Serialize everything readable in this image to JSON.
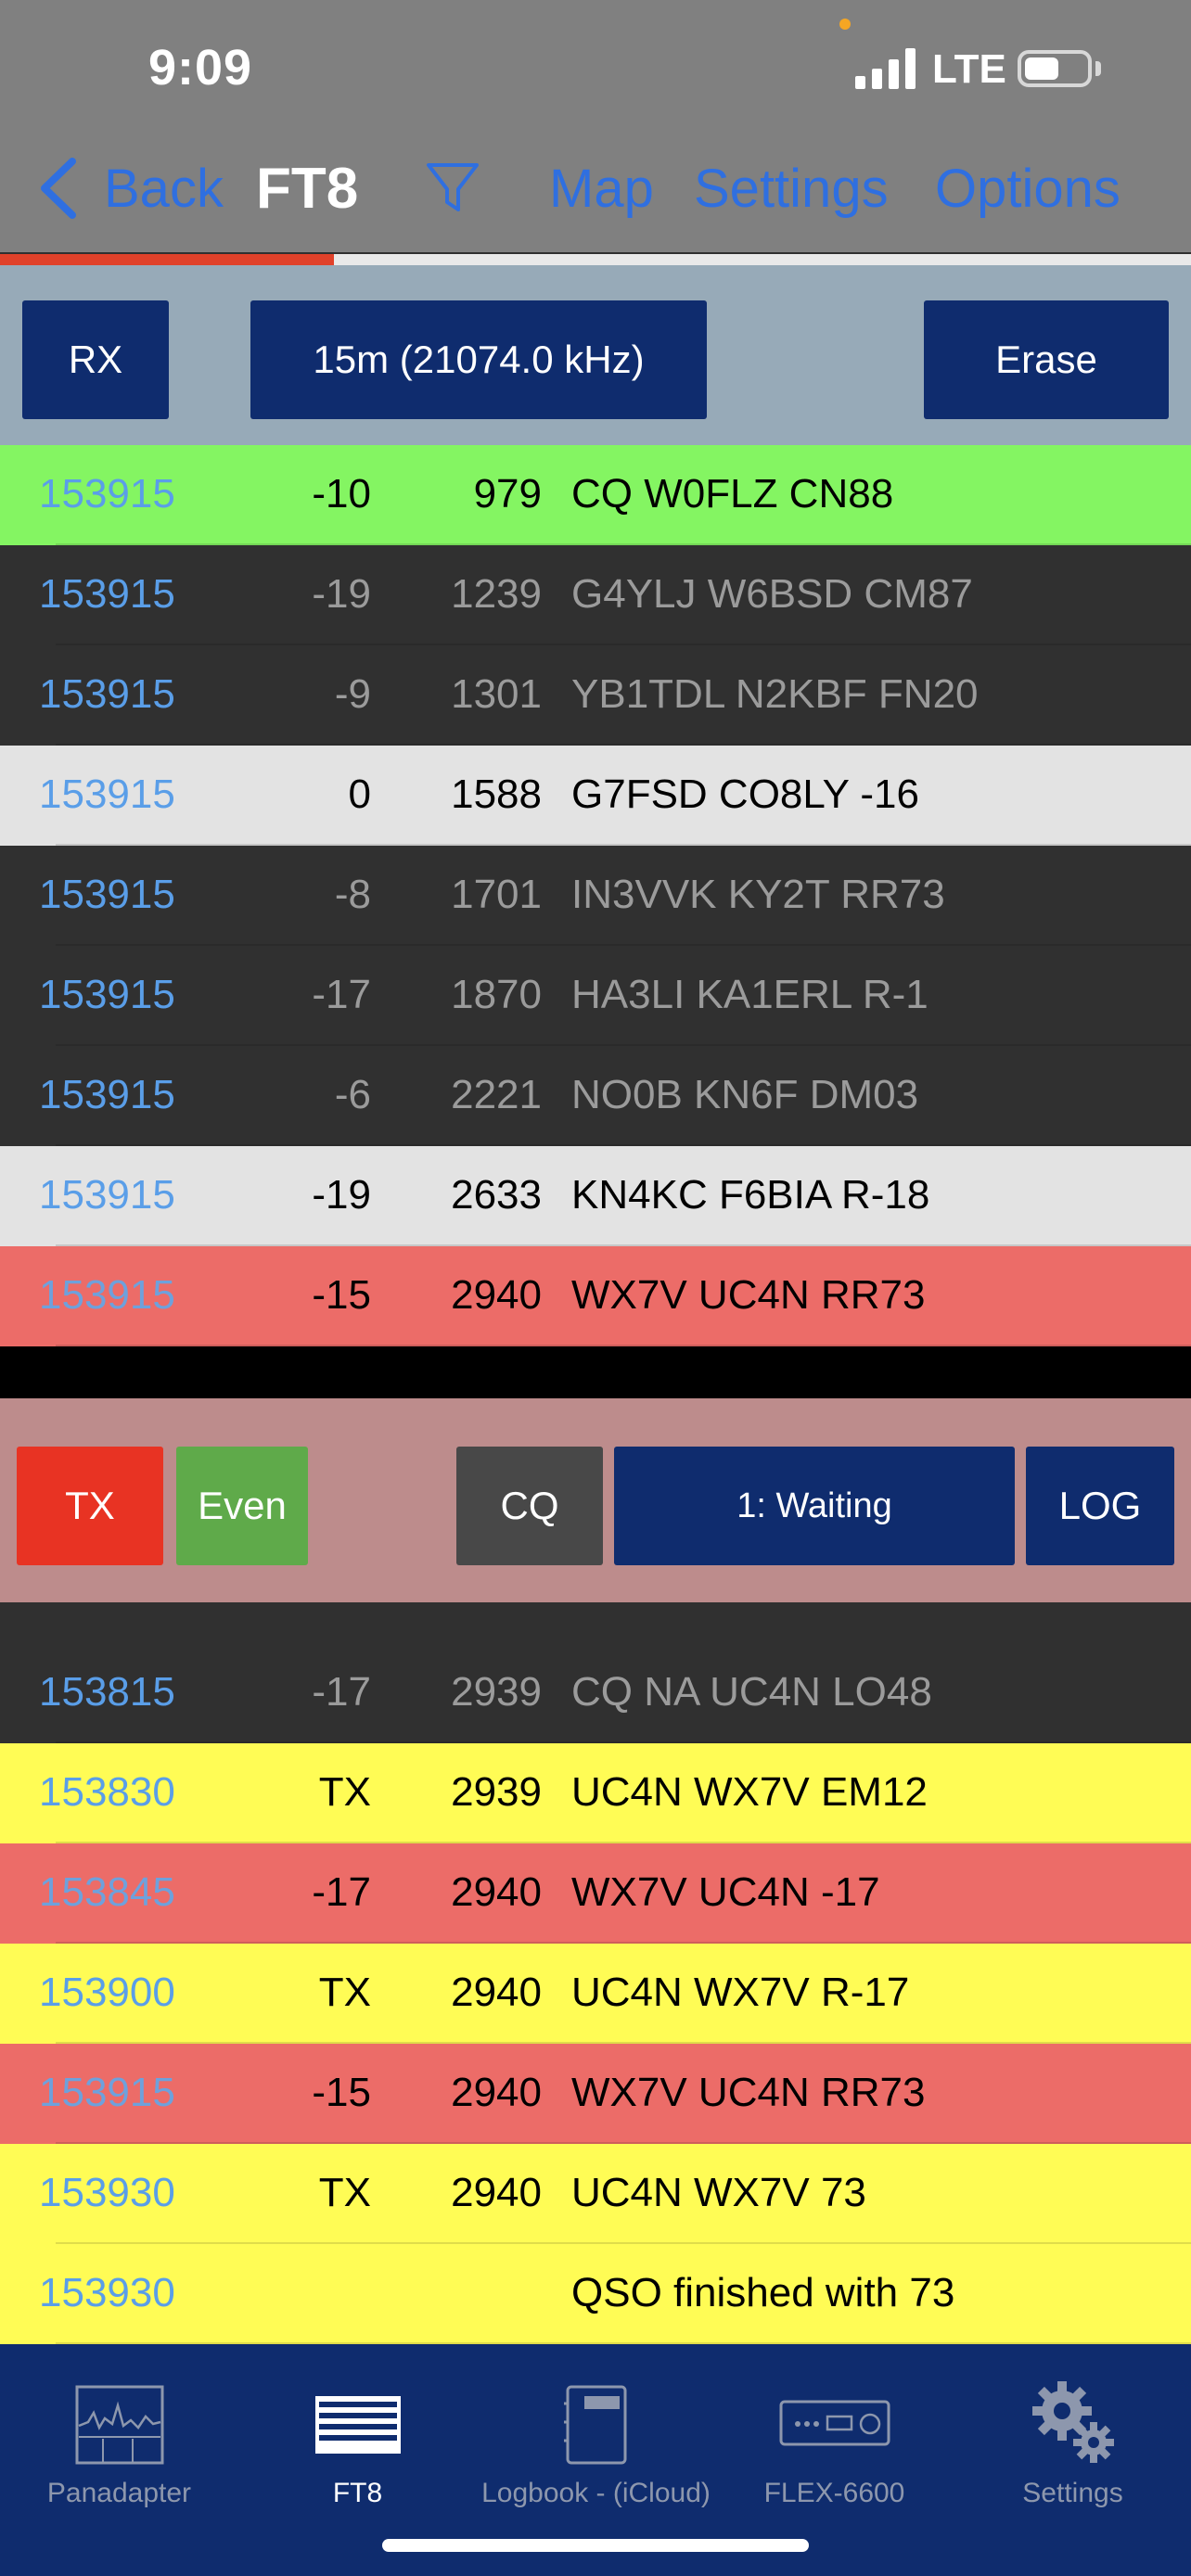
{
  "status": {
    "time": "9:09",
    "network": "LTE"
  },
  "nav": {
    "back": "Back",
    "title": "FT8",
    "map": "Map",
    "settings": "Settings",
    "options": "Options",
    "progress": 0.28
  },
  "controls": {
    "rx": "RX",
    "band": "15m (21074.0 kHz)",
    "erase": "Erase"
  },
  "decodes": [
    {
      "time": "153915",
      "db": "-10",
      "df": "979",
      "msg": "CQ W0FLZ CN88",
      "style": "green"
    },
    {
      "time": "153915",
      "db": "-19",
      "df": "1239",
      "msg": "G4YLJ W6BSD CM87",
      "style": "dark"
    },
    {
      "time": "153915",
      "db": "-9",
      "df": "1301",
      "msg": "YB1TDL N2KBF FN20",
      "style": "dark"
    },
    {
      "time": "153915",
      "db": "0",
      "df": "1588",
      "msg": "G7FSD CO8LY -16",
      "style": "light"
    },
    {
      "time": "153915",
      "db": "-8",
      "df": "1701",
      "msg": "IN3VVK KY2T RR73",
      "style": "dark"
    },
    {
      "time": "153915",
      "db": "-17",
      "df": "1870",
      "msg": "HA3LI KA1ERL R-1",
      "style": "dark"
    },
    {
      "time": "153915",
      "db": "-6",
      "df": "2221",
      "msg": "NO0B KN6F DM03",
      "style": "dark"
    },
    {
      "time": "153915",
      "db": "-19",
      "df": "2633",
      "msg": "KN4KC F6BIA R-18",
      "style": "light"
    },
    {
      "time": "153915",
      "db": "-15",
      "df": "2940",
      "msg": "WX7V UC4N RR73",
      "style": "red"
    }
  ],
  "tx_controls": {
    "tx": "TX",
    "parity": "Even",
    "cq": "CQ",
    "state": "1: Waiting",
    "log": "LOG"
  },
  "qso_log": [
    {
      "time": "153815",
      "db": "-17",
      "df": "2939",
      "msg": "CQ NA UC4N LO48",
      "style": "dark"
    },
    {
      "time": "153830",
      "db": "TX",
      "df": "2939",
      "msg": "UC4N WX7V EM12",
      "style": "yellow"
    },
    {
      "time": "153845",
      "db": "-17",
      "df": "2940",
      "msg": "WX7V UC4N -17",
      "style": "red"
    },
    {
      "time": "153900",
      "db": "TX",
      "df": "2940",
      "msg": "UC4N WX7V R-17",
      "style": "yellow"
    },
    {
      "time": "153915",
      "db": "-15",
      "df": "2940",
      "msg": "WX7V UC4N RR73",
      "style": "red"
    },
    {
      "time": "153930",
      "db": "TX",
      "df": "2940",
      "msg": "UC4N WX7V 73",
      "style": "yellow"
    },
    {
      "time": "153930",
      "db": "",
      "df": "",
      "msg": "QSO finished with 73",
      "style": "yellow"
    }
  ],
  "tabs": [
    {
      "label": "Panadapter",
      "icon": "panadapter-icon"
    },
    {
      "label": "FT8",
      "icon": "ft8-icon"
    },
    {
      "label": "Logbook - (iCloud)",
      "icon": "logbook-icon"
    },
    {
      "label": "FLEX-6600",
      "icon": "radio-icon"
    },
    {
      "label": "Settings",
      "icon": "gear-icon"
    }
  ],
  "colors": {
    "accent": "#2f6fe0",
    "button": "#0f2c6e",
    "tx": "#e83323",
    "even": "#5faa4a",
    "decode_green": "#84f562",
    "tx_yellow": "#fffc55",
    "rx_red": "#ec6c68"
  }
}
